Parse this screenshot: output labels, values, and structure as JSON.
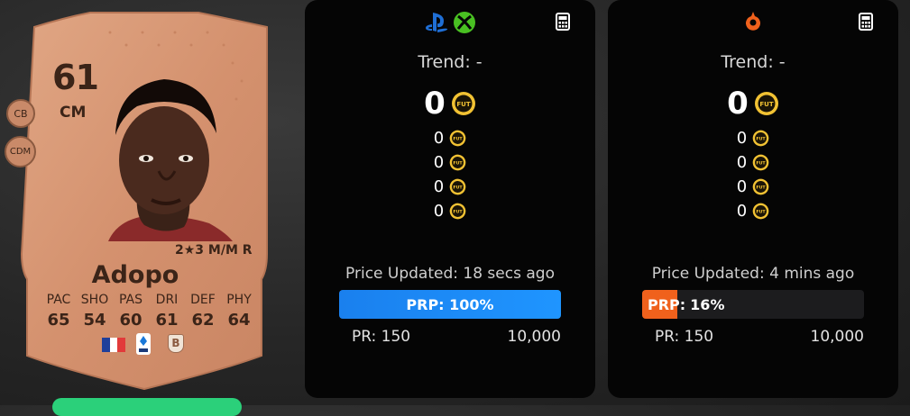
{
  "player_card": {
    "rating": "61",
    "position": "CM",
    "alt_positions": [
      "CB",
      "CDM"
    ],
    "skills": "2★3 M/M R",
    "name": "Adopo",
    "stat_labels": [
      "PAC",
      "SHO",
      "PAS",
      "DRI",
      "DEF",
      "PHY"
    ],
    "stat_values": [
      "65",
      "54",
      "60",
      "61",
      "62",
      "64"
    ],
    "nation_icon": "france-flag-icon",
    "league_icon": "serie-a-badge-icon",
    "club_icon": "club-crest-icon",
    "card_color": "#d99a78"
  },
  "panels": [
    {
      "platform_icons": [
        "playstation-icon",
        "xbox-icon"
      ],
      "trend": "Trend: -",
      "price": "0",
      "prices": [
        "0",
        "0",
        "0",
        "0"
      ],
      "updated": "Price Updated: 18 secs ago",
      "prp_label": "PRP: 100%",
      "prp_percent": 100,
      "range_min": "PR: 150",
      "range_max": "10,000",
      "bar_color": "#1f8fff"
    },
    {
      "platform_icons": [
        "origin-icon"
      ],
      "trend": "Trend: -",
      "price": "0",
      "prices": [
        "0",
        "0",
        "0",
        "0"
      ],
      "updated": "Price Updated: 4 mins ago",
      "prp_label": "PRP:",
      "prp_value": "16%",
      "prp_percent": 16,
      "range_min": "PR: 150",
      "range_max": "10,000",
      "bar_color": "#f0611c"
    }
  ],
  "colors": {
    "coin": "#f2c233",
    "panel_bg": "#050505"
  }
}
